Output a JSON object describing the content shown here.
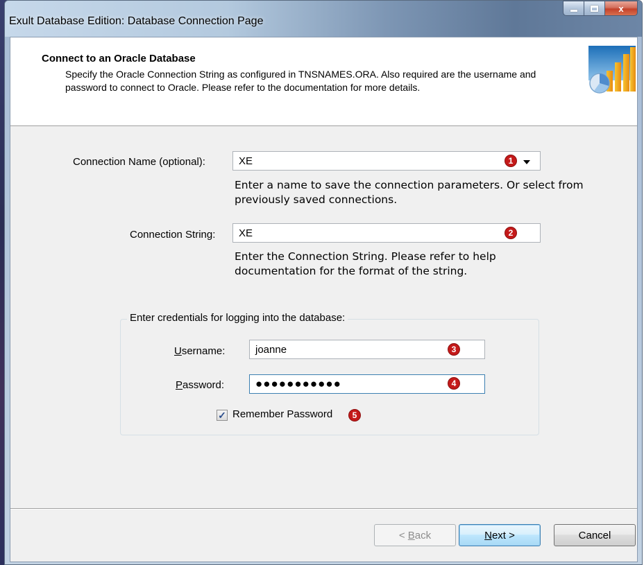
{
  "window": {
    "title": "Exult Database Edition: Database Connection Page",
    "min_icon": "minimize-icon",
    "max_icon": "maximize-icon",
    "close_label": "x"
  },
  "header": {
    "title": "Connect to an Oracle Database",
    "description": "Specify the Oracle Connection String as configured in TNSNAMES.ORA. Also required are the username and password to connect to Oracle. Please refer to the documentation for more details.",
    "logo_icon": "chart-wizard-logo-icon"
  },
  "connection_name": {
    "label": "Connection Name (optional):",
    "value": "XE",
    "hint": "Enter a name to save the connection parameters. Or select from previously saved connections.",
    "badge": "1"
  },
  "connection_string": {
    "label": "Connection String:",
    "value": "XE",
    "hint": "Enter the Connection String. Please refer to help documentation for the format of the string.",
    "badge": "2"
  },
  "credentials": {
    "group_label": "Enter credentials for logging into the database:",
    "username_label_accel": "U",
    "username_label_rest": "sername:",
    "username_value": "joanne",
    "username_badge": "3",
    "password_label_accel": "P",
    "password_label_rest": "assword:",
    "password_value": "●●●●●●●●●●●",
    "password_badge": "4",
    "remember_label": "Remember Password",
    "remember_checked": true,
    "remember_badge": "5"
  },
  "buttons": {
    "back_prefix": "< ",
    "back_accel": "B",
    "back_rest": "ack",
    "next_accel": "N",
    "next_rest": "ext >",
    "cancel": "Cancel"
  },
  "colors": {
    "badge": "#c41a1a",
    "focus_border": "#3c7fb1",
    "dialog_bg": "#f0f0f0"
  }
}
